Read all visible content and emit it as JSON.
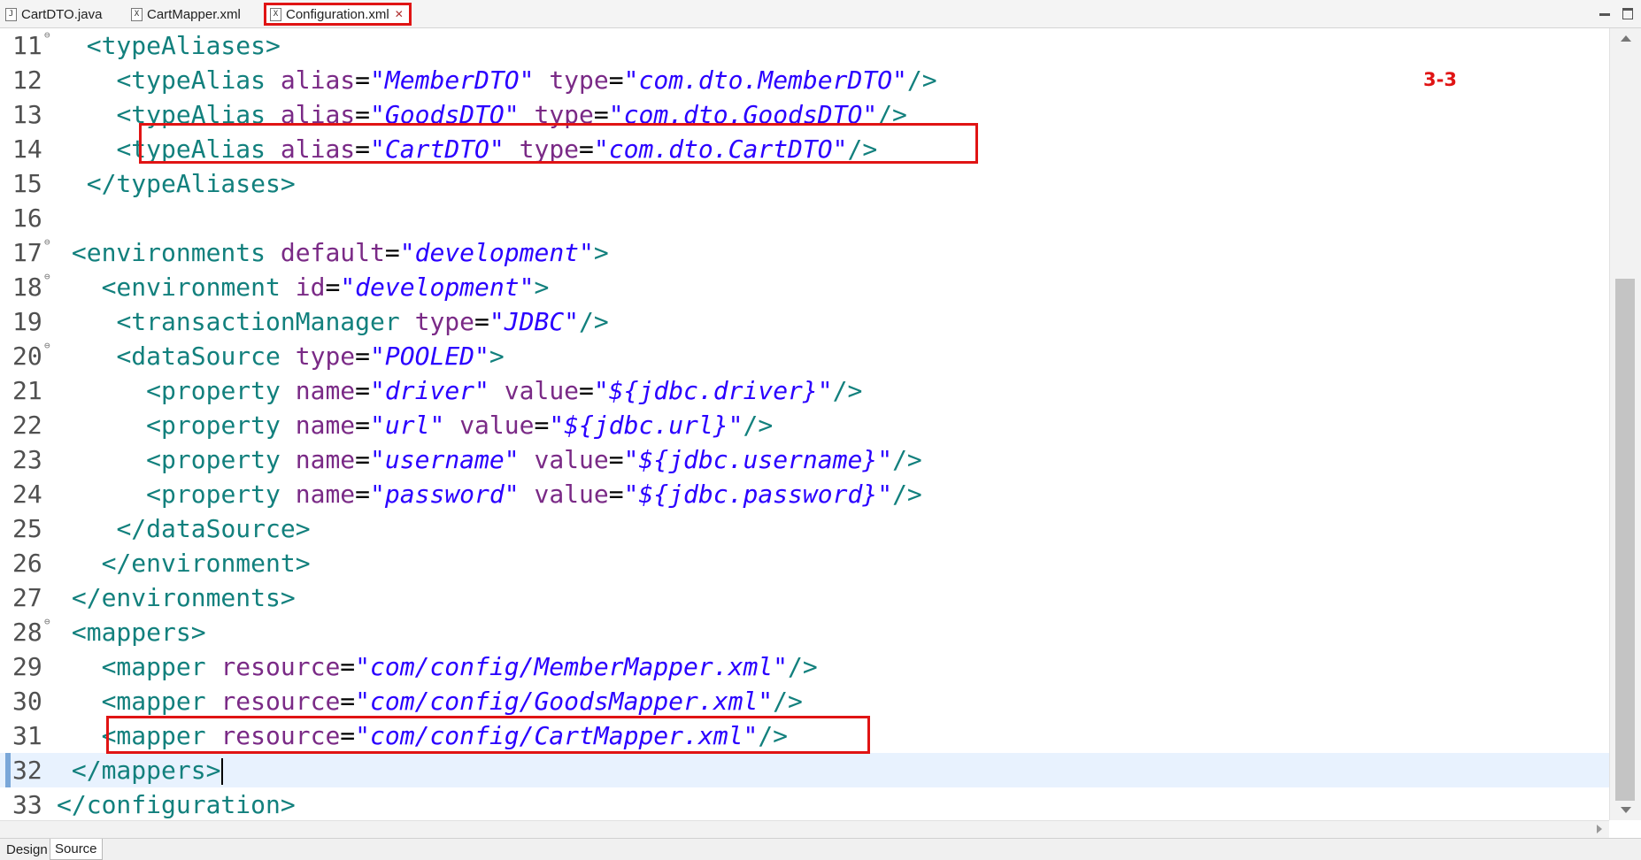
{
  "tabs": [
    {
      "label": "CartDTO.java",
      "icon": "java-file-icon"
    },
    {
      "label": "CartMapper.xml",
      "icon": "xml-file-icon"
    },
    {
      "label": "Configuration.xml",
      "icon": "xml-file-icon",
      "active": true,
      "close": "✕"
    }
  ],
  "file_icon_glyphs": {
    "java": "J",
    "xml": "X"
  },
  "annotation": "3-3",
  "lines": [
    {
      "n": "11",
      "fold": "⊖",
      "indent": "  ",
      "parts": [
        [
          "tag",
          "<typeAliases>"
        ]
      ]
    },
    {
      "n": "12",
      "indent": "    ",
      "parts": [
        [
          "tag",
          "<typeAlias "
        ],
        [
          "attr",
          "alias"
        ],
        [
          "pun",
          "="
        ],
        [
          "str",
          "\"MemberDTO\""
        ],
        [
          "pun",
          " "
        ],
        [
          "attr",
          "type"
        ],
        [
          "pun",
          "="
        ],
        [
          "str",
          "\"com.dto.MemberDTO\""
        ],
        [
          "tag",
          "/>"
        ]
      ]
    },
    {
      "n": "13",
      "indent": "    ",
      "parts": [
        [
          "tag",
          "<typeAlias "
        ],
        [
          "attr",
          "alias"
        ],
        [
          "pun",
          "="
        ],
        [
          "str",
          "\"GoodsDTO\""
        ],
        [
          "pun",
          " "
        ],
        [
          "attr",
          "type"
        ],
        [
          "pun",
          "="
        ],
        [
          "str",
          "\"com.dto.GoodsDTO\""
        ],
        [
          "tag",
          "/>"
        ]
      ]
    },
    {
      "n": "14",
      "indent": "    ",
      "parts": [
        [
          "tag",
          "<typeAlias "
        ],
        [
          "attr",
          "alias"
        ],
        [
          "pun",
          "="
        ],
        [
          "str",
          "\"CartDTO\""
        ],
        [
          "pun",
          " "
        ],
        [
          "attr",
          "type"
        ],
        [
          "pun",
          "="
        ],
        [
          "str",
          "\"com.dto.CartDTO\""
        ],
        [
          "tag",
          "/>"
        ]
      ]
    },
    {
      "n": "15",
      "indent": "  ",
      "parts": [
        [
          "tag",
          "</typeAliases>"
        ]
      ]
    },
    {
      "n": "16",
      "indent": "",
      "parts": []
    },
    {
      "n": "17",
      "fold": "⊖",
      "indent": " ",
      "parts": [
        [
          "tag",
          "<environments "
        ],
        [
          "attr",
          "default"
        ],
        [
          "pun",
          "="
        ],
        [
          "str",
          "\"development\""
        ],
        [
          "tag",
          ">"
        ]
      ]
    },
    {
      "n": "18",
      "fold": "⊖",
      "indent": "   ",
      "parts": [
        [
          "tag",
          "<environment "
        ],
        [
          "attr",
          "id"
        ],
        [
          "pun",
          "="
        ],
        [
          "str",
          "\"development\""
        ],
        [
          "tag",
          ">"
        ]
      ]
    },
    {
      "n": "19",
      "indent": "    ",
      "parts": [
        [
          "tag",
          "<transactionManager "
        ],
        [
          "attr",
          "type"
        ],
        [
          "pun",
          "="
        ],
        [
          "str",
          "\"JDBC\""
        ],
        [
          "tag",
          "/>"
        ]
      ]
    },
    {
      "n": "20",
      "fold": "⊖",
      "indent": "    ",
      "parts": [
        [
          "tag",
          "<dataSource "
        ],
        [
          "attr",
          "type"
        ],
        [
          "pun",
          "="
        ],
        [
          "str",
          "\"POOLED\""
        ],
        [
          "tag",
          ">"
        ]
      ]
    },
    {
      "n": "21",
      "indent": "      ",
      "parts": [
        [
          "tag",
          "<property "
        ],
        [
          "attr",
          "name"
        ],
        [
          "pun",
          "="
        ],
        [
          "str",
          "\"driver\""
        ],
        [
          "pun",
          " "
        ],
        [
          "attr",
          "value"
        ],
        [
          "pun",
          "="
        ],
        [
          "str",
          "\"${jdbc.driver}\""
        ],
        [
          "tag",
          "/>"
        ]
      ]
    },
    {
      "n": "22",
      "indent": "      ",
      "parts": [
        [
          "tag",
          "<property "
        ],
        [
          "attr",
          "name"
        ],
        [
          "pun",
          "="
        ],
        [
          "str",
          "\"url\""
        ],
        [
          "pun",
          " "
        ],
        [
          "attr",
          "value"
        ],
        [
          "pun",
          "="
        ],
        [
          "str",
          "\"${jdbc.url}\""
        ],
        [
          "tag",
          "/>"
        ]
      ]
    },
    {
      "n": "23",
      "indent": "      ",
      "parts": [
        [
          "tag",
          "<property "
        ],
        [
          "attr",
          "name"
        ],
        [
          "pun",
          "="
        ],
        [
          "str",
          "\"username\""
        ],
        [
          "pun",
          " "
        ],
        [
          "attr",
          "value"
        ],
        [
          "pun",
          "="
        ],
        [
          "str",
          "\"${jdbc.username}\""
        ],
        [
          "tag",
          "/>"
        ]
      ]
    },
    {
      "n": "24",
      "indent": "      ",
      "parts": [
        [
          "tag",
          "<property "
        ],
        [
          "attr",
          "name"
        ],
        [
          "pun",
          "="
        ],
        [
          "str",
          "\"password\""
        ],
        [
          "pun",
          " "
        ],
        [
          "attr",
          "value"
        ],
        [
          "pun",
          "="
        ],
        [
          "str",
          "\"${jdbc.password}\""
        ],
        [
          "tag",
          "/>"
        ]
      ]
    },
    {
      "n": "25",
      "indent": "    ",
      "parts": [
        [
          "tag",
          "</dataSource>"
        ]
      ]
    },
    {
      "n": "26",
      "indent": "   ",
      "parts": [
        [
          "tag",
          "</environment>"
        ]
      ]
    },
    {
      "n": "27",
      "indent": " ",
      "parts": [
        [
          "tag",
          "</environments>"
        ]
      ]
    },
    {
      "n": "28",
      "fold": "⊖",
      "indent": " ",
      "parts": [
        [
          "tag",
          "<mappers>"
        ]
      ]
    },
    {
      "n": "29",
      "indent": "   ",
      "parts": [
        [
          "tag",
          "<mapper "
        ],
        [
          "attr",
          "resource"
        ],
        [
          "pun",
          "="
        ],
        [
          "str",
          "\"com/config/MemberMapper.xml\""
        ],
        [
          "tag",
          "/>"
        ]
      ]
    },
    {
      "n": "30",
      "indent": "   ",
      "parts": [
        [
          "tag",
          "<mapper "
        ],
        [
          "attr",
          "resource"
        ],
        [
          "pun",
          "="
        ],
        [
          "str",
          "\"com/config/GoodsMapper.xml\""
        ],
        [
          "tag",
          "/>"
        ]
      ]
    },
    {
      "n": "31",
      "indent": "   ",
      "parts": [
        [
          "tag",
          "<mapper "
        ],
        [
          "attr",
          "resource"
        ],
        [
          "pun",
          "="
        ],
        [
          "str",
          "\"com/config/CartMapper.xml\""
        ],
        [
          "tag",
          "/>"
        ]
      ]
    },
    {
      "n": "32",
      "indent": " ",
      "current": true,
      "parts": [
        [
          "tag",
          "</mappers>"
        ]
      ]
    },
    {
      "n": "33",
      "indent": "",
      "parts": [
        [
          "tag",
          "</configuration>"
        ]
      ]
    }
  ],
  "bottom_tabs": {
    "design": "Design",
    "source": "Source"
  },
  "colors": {
    "tag": "#12807d",
    "attribute": "#7a2a86",
    "string": "#2a00ff",
    "highlight": "#e01414",
    "current_line": "#e8f2fe"
  }
}
